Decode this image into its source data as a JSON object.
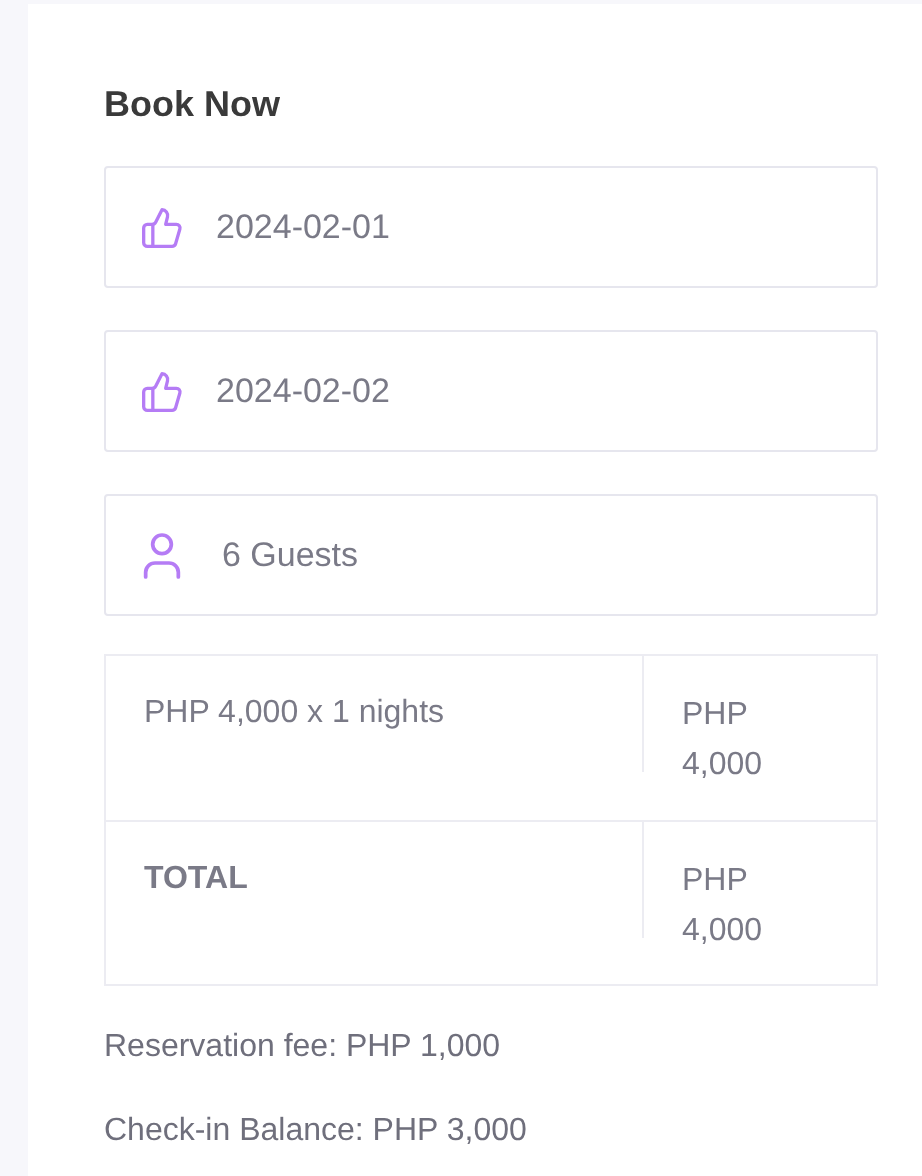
{
  "title": "Book Now",
  "fields": [
    {
      "kind": "date",
      "value": "2024-02-01"
    },
    {
      "kind": "date",
      "value": "2024-02-02"
    },
    {
      "kind": "guests",
      "value": "6 Guests"
    }
  ],
  "summary_rows": [
    {
      "label": "PHP 4,000 x 1 nights",
      "amount": "PHP 4,000",
      "bold": false
    },
    {
      "label": "TOTAL",
      "amount": "PHP 4,000",
      "bold": true
    }
  ],
  "notes": [
    "Reservation fee: PHP 1,000",
    "Check-in Balance: PHP 3,000"
  ]
}
